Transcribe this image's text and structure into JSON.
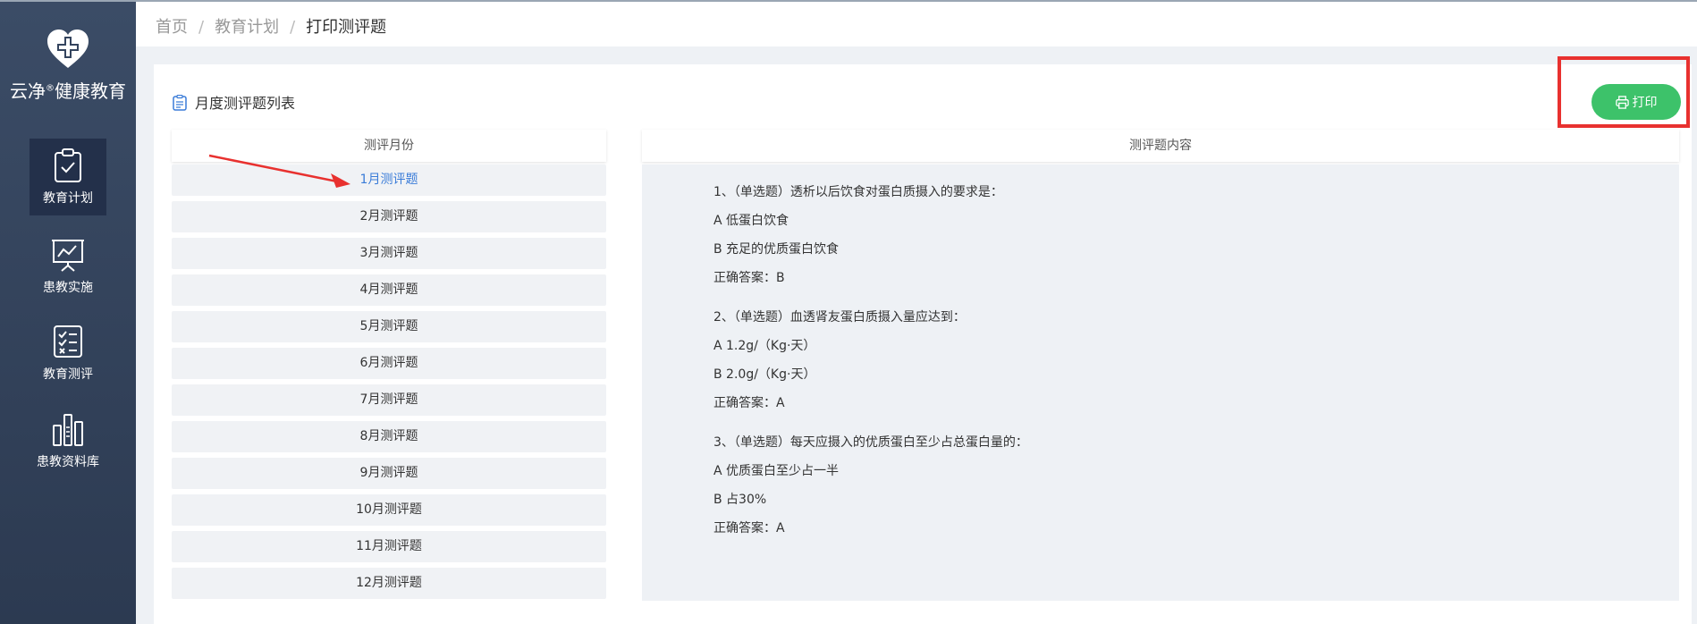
{
  "app": {
    "logo_text": "云净",
    "logo_reg": "®",
    "logo_text2": "健康教育"
  },
  "sidebar": {
    "items": [
      {
        "label": "教育计划",
        "icon": "clipboard-check-icon",
        "active": true
      },
      {
        "label": "患教实施",
        "icon": "presentation-chart-icon",
        "active": false
      },
      {
        "label": "教育测评",
        "icon": "checklist-icon",
        "active": false
      },
      {
        "label": "患教资料库",
        "icon": "library-icon",
        "active": false
      }
    ]
  },
  "breadcrumb": {
    "home": "首页",
    "sep1": "/",
    "parent": "教育计划",
    "sep2": "/",
    "current": "打印测评题"
  },
  "panel": {
    "title": "月度测评题列表",
    "print_label": "打印"
  },
  "month_column": {
    "header": "测评月份",
    "months": [
      "1月测评题",
      "2月测评题",
      "3月测评题",
      "4月测评题",
      "5月测评题",
      "6月测评题",
      "7月测评题",
      "8月测评题",
      "9月测评题",
      "10月测评题",
      "11月测评题",
      "12月测评题"
    ]
  },
  "content_column": {
    "header": "测评题内容",
    "questions": [
      {
        "q": "1、（单选题）透析以后饮食对蛋白质摄入的要求是：",
        "a": "A  低蛋白饮食",
        "b": "B  充足的优质蛋白饮食",
        "answer": "正确答案：B"
      },
      {
        "q": "2、（单选题）血透肾友蛋白质摄入量应达到：",
        "a": "A  1.2g/（Kg·天）",
        "b": "B  2.0g/（Kg·天）",
        "answer": "正确答案：A"
      },
      {
        "q": "3、（单选题）每天应摄入的优质蛋白至少占总蛋白量的：",
        "a": "A  优质蛋白至少占一半",
        "b": "B  占30%",
        "answer": "正确答案：A"
      }
    ]
  },
  "colors": {
    "sidebar": "#34445e",
    "accent": "#3dc26a",
    "highlight": "#e8312f",
    "active_link": "#3a7cd8"
  }
}
